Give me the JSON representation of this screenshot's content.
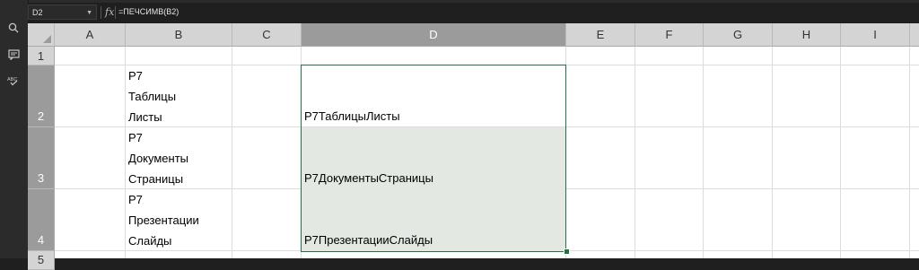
{
  "formula_bar": {
    "name_box": "D2",
    "fx_label": "fx",
    "formula": "=ПЕЧСИМВ(B2)"
  },
  "sidebar_icons": [
    "search-icon",
    "comment-icon",
    "spellcheck-icon"
  ],
  "columns": [
    "A",
    "B",
    "C",
    "D",
    "E",
    "F",
    "G",
    "H",
    "I"
  ],
  "rows": [
    "1",
    "2",
    "3",
    "4",
    "5"
  ],
  "active_cell": "D2",
  "cells": {
    "B2": [
      "Р7",
      "Таблицы",
      "Листы"
    ],
    "B3": [
      "Р7",
      "Документы",
      "Страницы"
    ],
    "B4": [
      "Р7",
      "Презентации",
      "Слайды"
    ],
    "D2": "Р7ТаблицыЛисты",
    "D3": "Р7ДокументыСтраницы",
    "D4": "Р7ПрезентацииСлайды"
  },
  "colors": {
    "selection_border": "#217346",
    "selection_fill": "#e3e8e3",
    "header_bg": "#d4d4d4",
    "header_active_bg": "#9b9b9b"
  }
}
